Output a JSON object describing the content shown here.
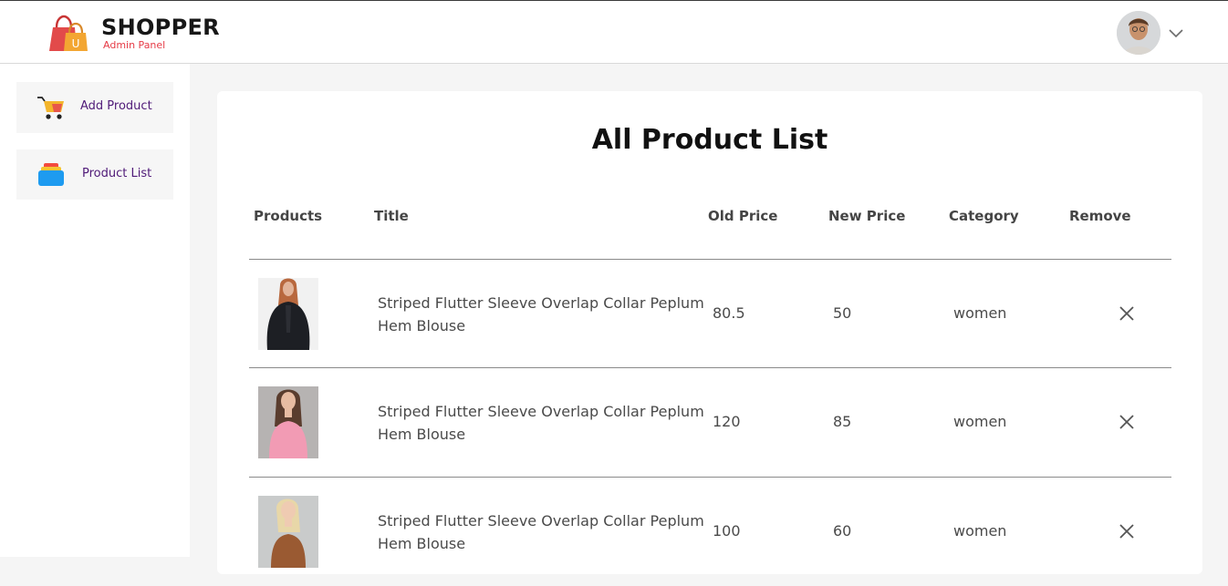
{
  "navbar": {
    "brand": "SHOPPER",
    "subtitle": "Admin Panel",
    "logo_icon": "shopping-bag-icon",
    "avatar_icon": "user-avatar",
    "dropdown_icon": "chevron-down-icon"
  },
  "sidebar": {
    "items": [
      {
        "label": "Add Product",
        "icon": "cart-icon"
      },
      {
        "label": "Product List",
        "icon": "stack-icon"
      }
    ]
  },
  "main": {
    "title": "All Product List",
    "columns": [
      "Products",
      "Title",
      "Old Price",
      "New Price",
      "Category",
      "Remove"
    ],
    "rows": [
      {
        "image": "black-fur-jacket-photo",
        "title": "Striped Flutter Sleeve Overlap Collar Peplum Hem Blouse",
        "old_price": "80.5",
        "new_price": "50",
        "category": "women"
      },
      {
        "image": "pink-top-photo",
        "title": "Striped Flutter Sleeve Overlap Collar Peplum Hem Blouse",
        "old_price": "120",
        "new_price": "85",
        "category": "women"
      },
      {
        "image": "blonde-brown-top-photo",
        "title": "Striped Flutter Sleeve Overlap Collar Peplum Hem Blouse",
        "old_price": "100",
        "new_price": "60",
        "category": "women"
      }
    ]
  },
  "colors": {
    "brand_text": "#171717",
    "subtitle": "#e63c47",
    "sidebar_label": "#4f1a78",
    "page_bg": "#f5f5f5"
  }
}
